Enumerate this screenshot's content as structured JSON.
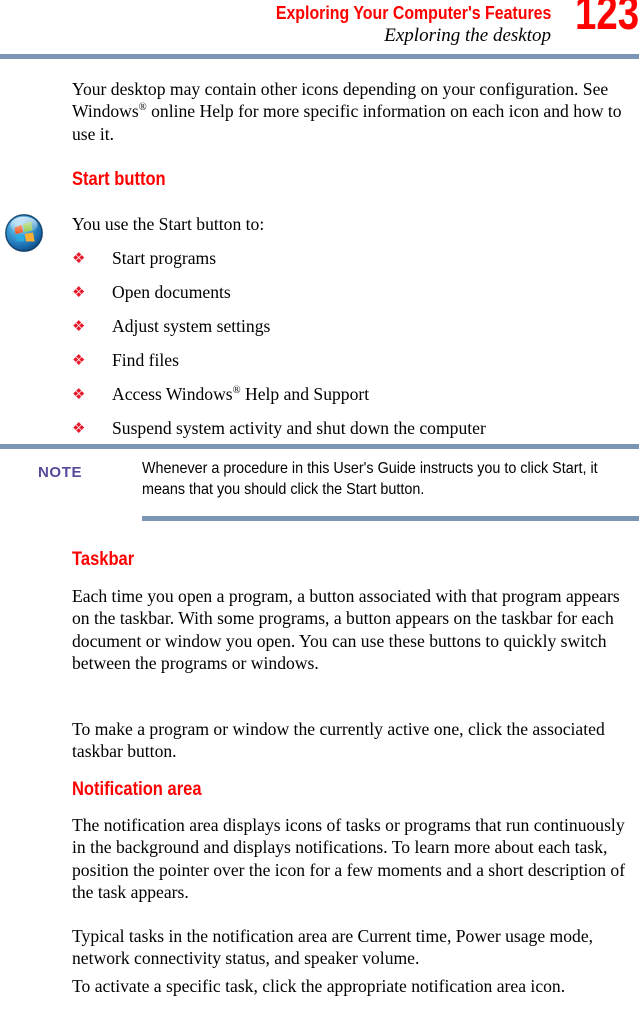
{
  "page": {
    "number": "123",
    "chapter_title": "Exploring Your Computer's Features",
    "section_title": "Exploring the desktop",
    "accent_red": "#ff0000",
    "rule_blue": "#7b96b4",
    "note_purple": "#55499b",
    "bullet_red": "#e8192c"
  },
  "intro": {
    "paragraph": "Your desktop may contain other icons depending on your configuration. See Windows® online Help for more specific information on each icon and how to use it."
  },
  "start_button_section": {
    "heading": "Start button",
    "lead_in": "You use the Start button to:",
    "icon_name": "windows-start-orb",
    "bullet_glyph": "❖",
    "bullets": [
      "Start programs",
      "Open documents",
      "Adjust system settings",
      "Find files",
      "Access Windows® Help and Support",
      "Suspend system activity and shut down the computer"
    ]
  },
  "note": {
    "label": "NOTE",
    "text": "Whenever a procedure in this User's Guide instructs you to click Start, it means that you should click the Start button."
  },
  "taskbar_section": {
    "heading": "Taskbar",
    "paragraphs": [
      "Each time you open a program, a button associated with that program appears on the taskbar. With some programs, a button appears on the taskbar for each document or window you open. You can use these buttons to quickly switch between the programs or windows.",
      "To make a program or window the currently active one, click the associated taskbar button."
    ]
  },
  "notification_section": {
    "heading": "Notification area",
    "paragraphs": [
      "The notification area displays icons of tasks or programs that run continuously in the background and displays notifications. To learn more about each task, position the pointer over the icon for a few moments and a short description of the task appears.",
      "Typical tasks in the notification area are Current time, Power usage mode, network connectivity status, and speaker volume.",
      "To activate a specific task, click the appropriate notification area icon."
    ]
  }
}
